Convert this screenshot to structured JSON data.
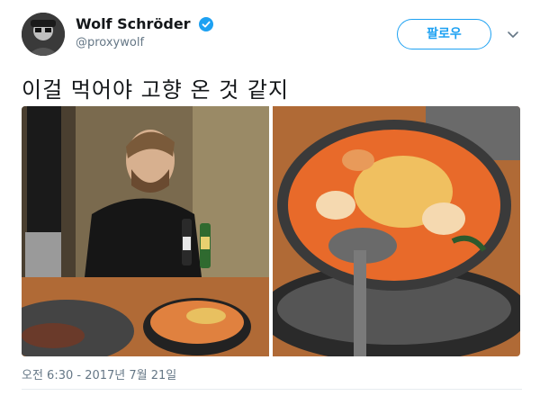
{
  "user": {
    "display_name": "Wolf Schröder",
    "handle": "@proxywolf",
    "verified": true
  },
  "follow_label": "팔로우",
  "tweet_text": "이걸 먹어야 고향 온 것 같지",
  "media": [
    {
      "icon": "photo-man-with-budae-jjigae"
    },
    {
      "icon": "photo-budae-jjigae-closeup"
    }
  ],
  "timestamp": "오전 6:30 - 2017년 7월 21일",
  "colors": {
    "accent": "#1da1f2",
    "text": "#14171a",
    "muted": "#657786",
    "divider": "#e6ecf0"
  }
}
